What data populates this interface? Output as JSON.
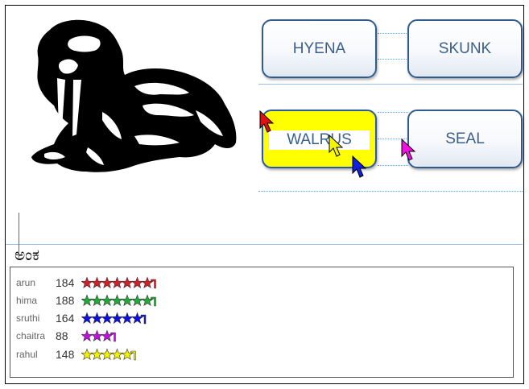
{
  "options": [
    {
      "label": "HYENA",
      "selected": false
    },
    {
      "label": "SKUNK",
      "selected": false
    },
    {
      "label": "WALRUS",
      "selected": true
    },
    {
      "label": "SEAL",
      "selected": false
    }
  ],
  "score_title": "ಅಂಕ",
  "players": [
    {
      "name": "arun",
      "score": "184",
      "stars": 7,
      "color": "#d0202a"
    },
    {
      "name": "hima",
      "score": "188",
      "stars": 7,
      "color": "#22a838"
    },
    {
      "name": "sruthi",
      "score": "164",
      "stars": 6,
      "color": "#1010e0"
    },
    {
      "name": "chaitra",
      "score": "88",
      "stars": 3,
      "color": "#c010e0"
    },
    {
      "name": "rahul",
      "score": "148",
      "stars": 5,
      "color": "#f0f000"
    }
  ],
  "cursors": [
    {
      "color": "#e01010"
    },
    {
      "color": "#f4f400"
    },
    {
      "color": "#1020e0"
    },
    {
      "color": "#f010e0"
    }
  ],
  "image_icon": "walrus-picture"
}
